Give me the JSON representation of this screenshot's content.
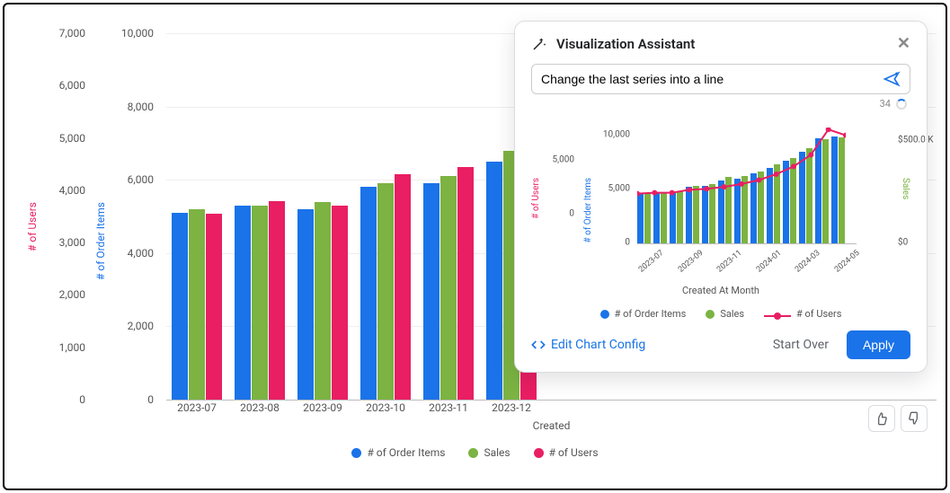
{
  "chart_data": {
    "type": "bar",
    "categories": [
      "2023-07",
      "2023-08",
      "2023-09",
      "2023-10",
      "2023-11",
      "2023-12"
    ],
    "series": [
      {
        "name": "# of Order Items",
        "axis": "order_items",
        "values": [
          5100,
          5300,
          5200,
          5800,
          5900,
          6500
        ],
        "color": "#1a73e8"
      },
      {
        "name": "Sales",
        "axis": "sales",
        "values": [
          5200,
          5300,
          5400,
          5900,
          6100,
          6800
        ],
        "color": "#7cb342"
      },
      {
        "name": "# of Users",
        "axis": "users",
        "values": [
          3550,
          3800,
          3700,
          4300,
          4450,
          4950
        ],
        "color": "#e91e63"
      }
    ],
    "axes": {
      "users": {
        "label": "# of Users",
        "range": [
          0,
          7000
        ],
        "ticks": [
          0,
          1000,
          2000,
          3000,
          4000,
          5000,
          6000,
          7000
        ],
        "tick_labels": [
          "0",
          "1,000",
          "2,000",
          "3,000",
          "4,000",
          "5,000",
          "6,000",
          "7,000"
        ]
      },
      "order_items": {
        "label": "# of Order Items",
        "range": [
          0,
          10000
        ],
        "ticks": [
          0,
          2000,
          4000,
          6000,
          8000,
          10000
        ],
        "tick_labels": [
          "0",
          "2,000",
          "4,000",
          "6,000",
          "8,000",
          "10,000"
        ]
      }
    },
    "xlabel": "Created",
    "legend": [
      "# of Order Items",
      "Sales",
      "# of Users"
    ]
  },
  "panel": {
    "title": "Visualization Assistant",
    "input_value": "Change the last series into a line",
    "counter": "34",
    "edit_link": "Edit Chart Config",
    "start_over": "Start Over",
    "apply": "Apply"
  },
  "preview_chart": {
    "type": "combo",
    "categories": [
      "2023-07",
      "2023-09",
      "2023-11",
      "2024-01",
      "2024-03",
      "2024-05"
    ],
    "bar_series": [
      {
        "name": "# of Order Items",
        "values": [
          5100,
          5300,
          5200,
          5800,
          5900,
          6500,
          6700,
          7200,
          7800,
          8500,
          9400,
          10800,
          11000
        ],
        "color": "#1a73e8"
      },
      {
        "name": "Sales",
        "values": [
          5200,
          5300,
          5400,
          5900,
          6100,
          6800,
          6900,
          7400,
          8100,
          8800,
          9800,
          10700,
          10900
        ],
        "color": "#7cb342"
      }
    ],
    "line_series": {
      "name": "# of Users",
      "values": [
        5200,
        5300,
        5300,
        5600,
        5700,
        5900,
        6200,
        6600,
        7200,
        8000,
        9200,
        11800,
        11200
      ],
      "color": "#e91e63"
    },
    "axes": {
      "users": {
        "label": "# of Users",
        "ticks": [
          "0",
          "5,000"
        ]
      },
      "order_items": {
        "label": "# of Order Items",
        "ticks": [
          "0",
          "5,000",
          "10,000"
        ]
      },
      "sales": {
        "label": "Sales",
        "ticks": [
          "$0",
          "$500.0 K"
        ]
      }
    },
    "xlabel": "Created At Month",
    "legend": [
      "# of Order Items",
      "Sales",
      "# of Users"
    ]
  }
}
